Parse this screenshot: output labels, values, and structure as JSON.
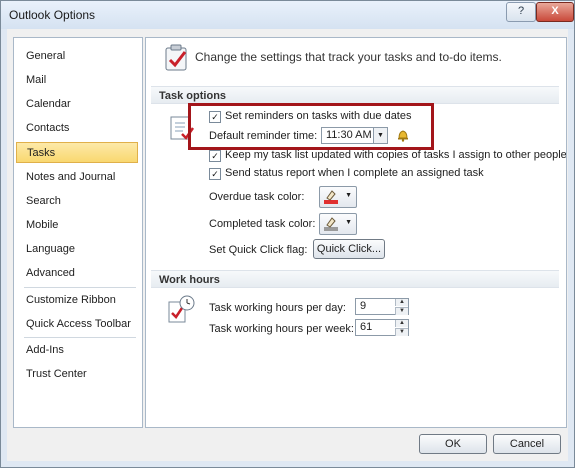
{
  "window": {
    "title": "Outlook Options",
    "help_label": "?",
    "close_label": "X"
  },
  "nav": {
    "items": [
      {
        "label": "General"
      },
      {
        "label": "Mail"
      },
      {
        "label": "Calendar"
      },
      {
        "label": "Contacts"
      },
      {
        "label": "Tasks"
      },
      {
        "label": "Notes and Journal"
      },
      {
        "label": "Search"
      },
      {
        "label": "Mobile"
      },
      {
        "label": "Language"
      },
      {
        "label": "Advanced"
      },
      {
        "label": "Customize Ribbon"
      },
      {
        "label": "Quick Access Toolbar"
      },
      {
        "label": "Add-Ins"
      },
      {
        "label": "Trust Center"
      }
    ],
    "selected": "Tasks"
  },
  "content": {
    "header": "Change the settings that track your tasks and to-do items.",
    "task_options": {
      "heading": "Task options",
      "set_reminders": "Set reminders on tasks with due dates",
      "default_reminder_label": "Default reminder time:",
      "default_reminder_value": "11:30 AM",
      "keep_updated": "Keep my task list updated with copies of tasks I assign to other people",
      "send_status": "Send status report when I complete an assigned task",
      "overdue_label": "Overdue task color:",
      "completed_label": "Completed task color:",
      "quick_click_label": "Set Quick Click flag:",
      "quick_click_button": "Quick Click..."
    },
    "work_hours": {
      "heading": "Work hours",
      "per_day_label": "Task working hours per day:",
      "per_day_value": "9",
      "per_week_label": "Task working hours per week:",
      "per_week_value": "61"
    }
  },
  "footer": {
    "ok_label": "OK",
    "cancel_label": "Cancel"
  },
  "colors": {
    "highlight": "#a3151a",
    "selected_nav": "#f9d870"
  }
}
